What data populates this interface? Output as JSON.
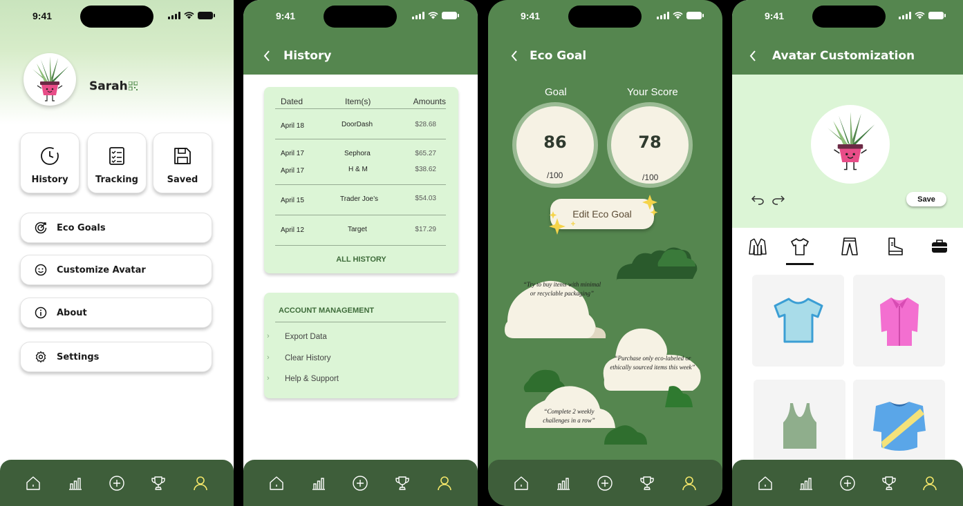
{
  "status": {
    "time": "9:41"
  },
  "profile": {
    "username": "Sarah",
    "tiles": [
      {
        "label": "History",
        "icon": "clock-icon"
      },
      {
        "label": "Tracking",
        "icon": "checklist-icon"
      },
      {
        "label": "Saved",
        "icon": "floppy-icon"
      }
    ],
    "menu": [
      {
        "label": "Eco Goals",
        "icon": "target-icon"
      },
      {
        "label": "Customize Avatar",
        "icon": "smiley-icon"
      },
      {
        "label": "About",
        "icon": "info-icon"
      },
      {
        "label": "Settings",
        "icon": "gear-icon"
      }
    ]
  },
  "history": {
    "title": "History",
    "columns": [
      "Dated",
      "Item(s)",
      "Amounts"
    ],
    "rows": [
      {
        "date": "April 18",
        "item": "DoorDash",
        "amount": "$28.68"
      },
      {
        "date": "April 17",
        "item": "Sephora",
        "amount": "$65.27"
      },
      {
        "date": "April 17",
        "item": "H & M",
        "amount": "$38.62"
      },
      {
        "date": "April 15",
        "item": "Trader Joe’s",
        "amount": "$54.03"
      },
      {
        "date": "April 12",
        "item": "Target",
        "amount": "$17.29"
      }
    ],
    "all_label": "ALL HISTORY",
    "account": {
      "title": "ACCOUNT MANAGEMENT",
      "items": [
        "Export Data",
        "Clear History",
        "Help & Support"
      ]
    }
  },
  "ecogoal": {
    "title": "Eco Goal",
    "goal_label": "Goal",
    "score_label": "Your Score",
    "goal_value": "86",
    "score_value": "78",
    "goal_out_of": "/100",
    "score_out_of": "/100",
    "edit_label": "Edit Eco Goal",
    "quotes": [
      "“Try to buy items with minimal or recyclable packaging”",
      "“Purchase only eco-labeled or ethically sourced items this week”",
      "“Complete 2 weekly challenges in a row”"
    ]
  },
  "avatar": {
    "title": "Avatar Customization",
    "save_label": "Save",
    "categories": [
      "jacket-icon",
      "tshirt-icon",
      "pants-icon",
      "boot-icon",
      "bag-icon"
    ],
    "selected_category": "tshirt-icon",
    "items": [
      "blue-tshirt",
      "pink-blouse",
      "green-tank-top",
      "striped-jersey"
    ]
  },
  "colors": {
    "primary_green": "#55864f",
    "dark_green": "#3e5e3a",
    "light_green": "#dcf5d6",
    "cream": "#f6f2e4",
    "active_tab": "#f5e86a"
  }
}
